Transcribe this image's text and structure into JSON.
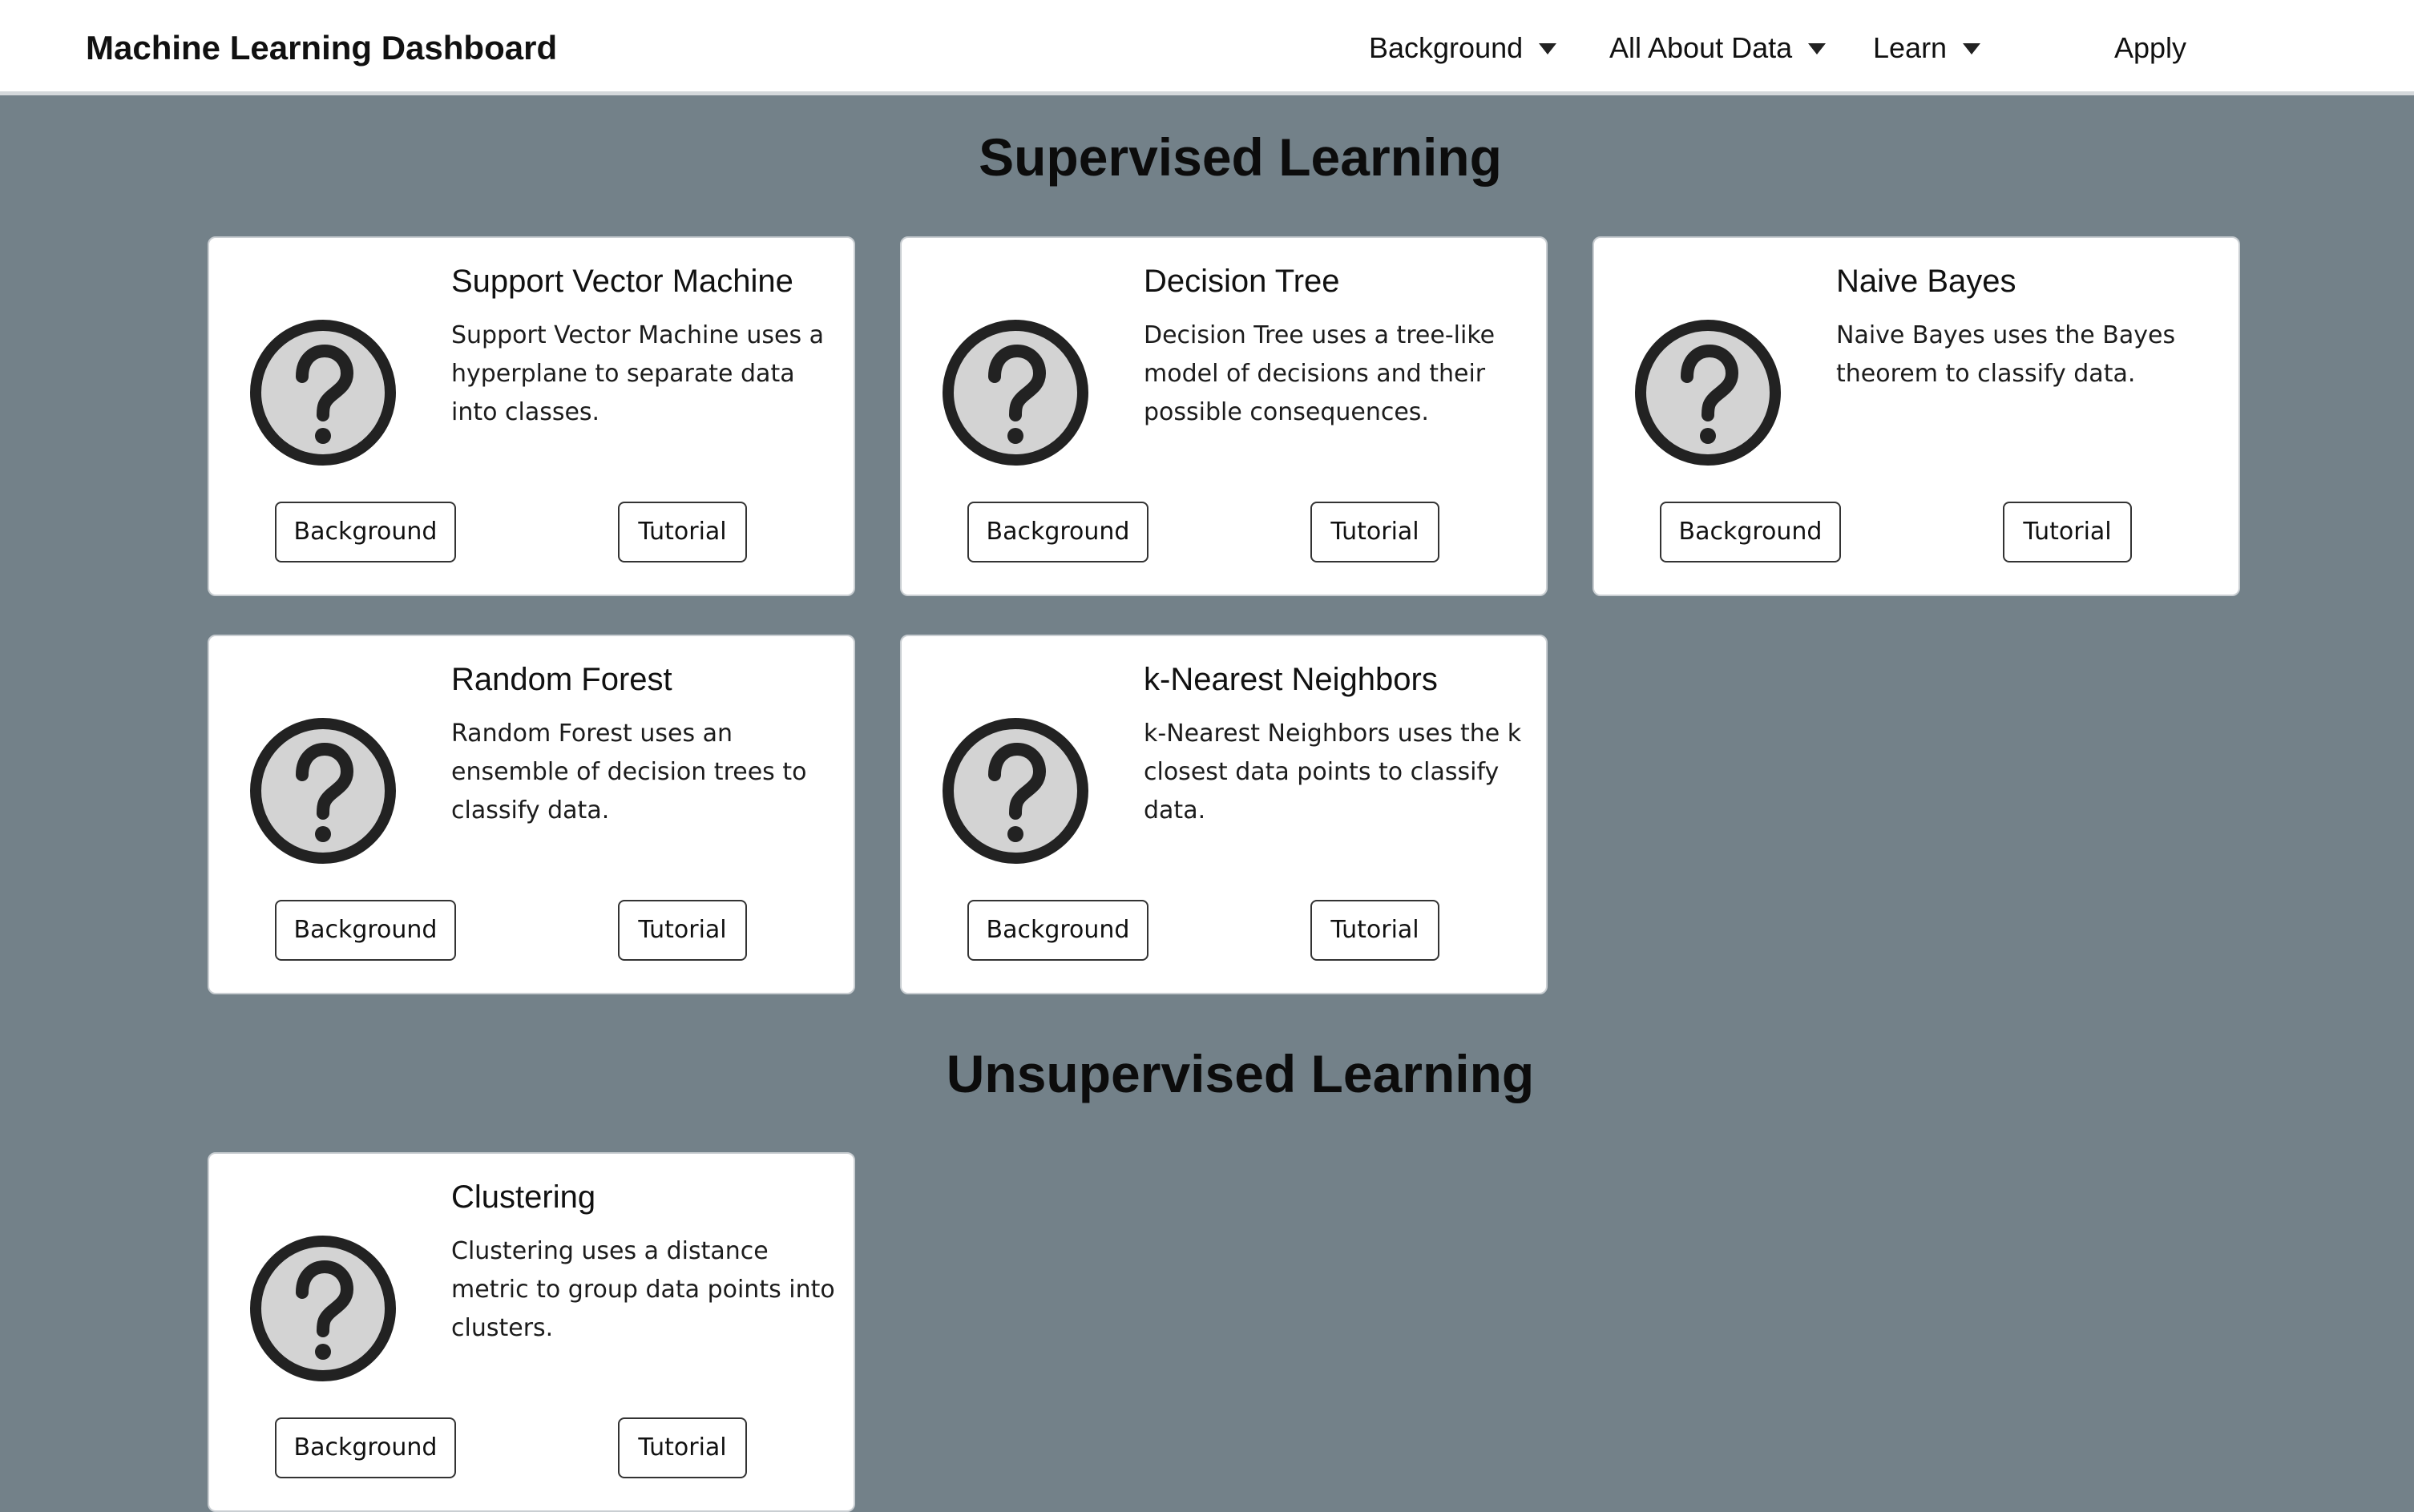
{
  "navbar": {
    "brand": "Machine Learning Dashboard",
    "items": [
      {
        "label": "Background",
        "dropdown": true
      },
      {
        "label": "All About Data",
        "dropdown": true
      },
      {
        "label": "Learn",
        "dropdown": true
      },
      {
        "label": "Apply",
        "dropdown": false
      }
    ]
  },
  "sections": [
    {
      "title": "Supervised Learning",
      "cards": [
        {
          "title": "Support Vector Machine",
          "description": "Support Vector Machine uses a hyperplane to separate data into classes.",
          "icon": "question-mark-icon",
          "background_label": "Background",
          "tutorial_label": "Tutorial"
        },
        {
          "title": "Decision Tree",
          "description": "Decision Tree uses a tree-like model of decisions and their possible consequences.",
          "icon": "question-mark-icon",
          "background_label": "Background",
          "tutorial_label": "Tutorial"
        },
        {
          "title": "Naive Bayes",
          "description": "Naive Bayes uses the Bayes theorem to classify data.",
          "icon": "question-mark-icon",
          "background_label": "Background",
          "tutorial_label": "Tutorial"
        },
        {
          "title": "Random Forest",
          "description": "Random Forest uses an ensemble of decision trees to classify data.",
          "icon": "question-mark-icon",
          "background_label": "Background",
          "tutorial_label": "Tutorial"
        },
        {
          "title": "k-Nearest Neighbors",
          "description": "k-Nearest Neighbors uses the k closest data points to classify data.",
          "icon": "question-mark-icon",
          "background_label": "Background",
          "tutorial_label": "Tutorial"
        }
      ]
    },
    {
      "title": "Unsupervised Learning",
      "cards": [
        {
          "title": "Clustering",
          "description": "Clustering uses a distance metric to group data points into clusters.",
          "icon": "question-mark-icon",
          "background_label": "Background",
          "tutorial_label": "Tutorial"
        }
      ]
    }
  ],
  "colors": {
    "page_background": "#738189",
    "navbar_background": "#ffffff",
    "card_background": "#ffffff",
    "icon_fill": "#d3d3d3",
    "icon_stroke": "#222222"
  }
}
